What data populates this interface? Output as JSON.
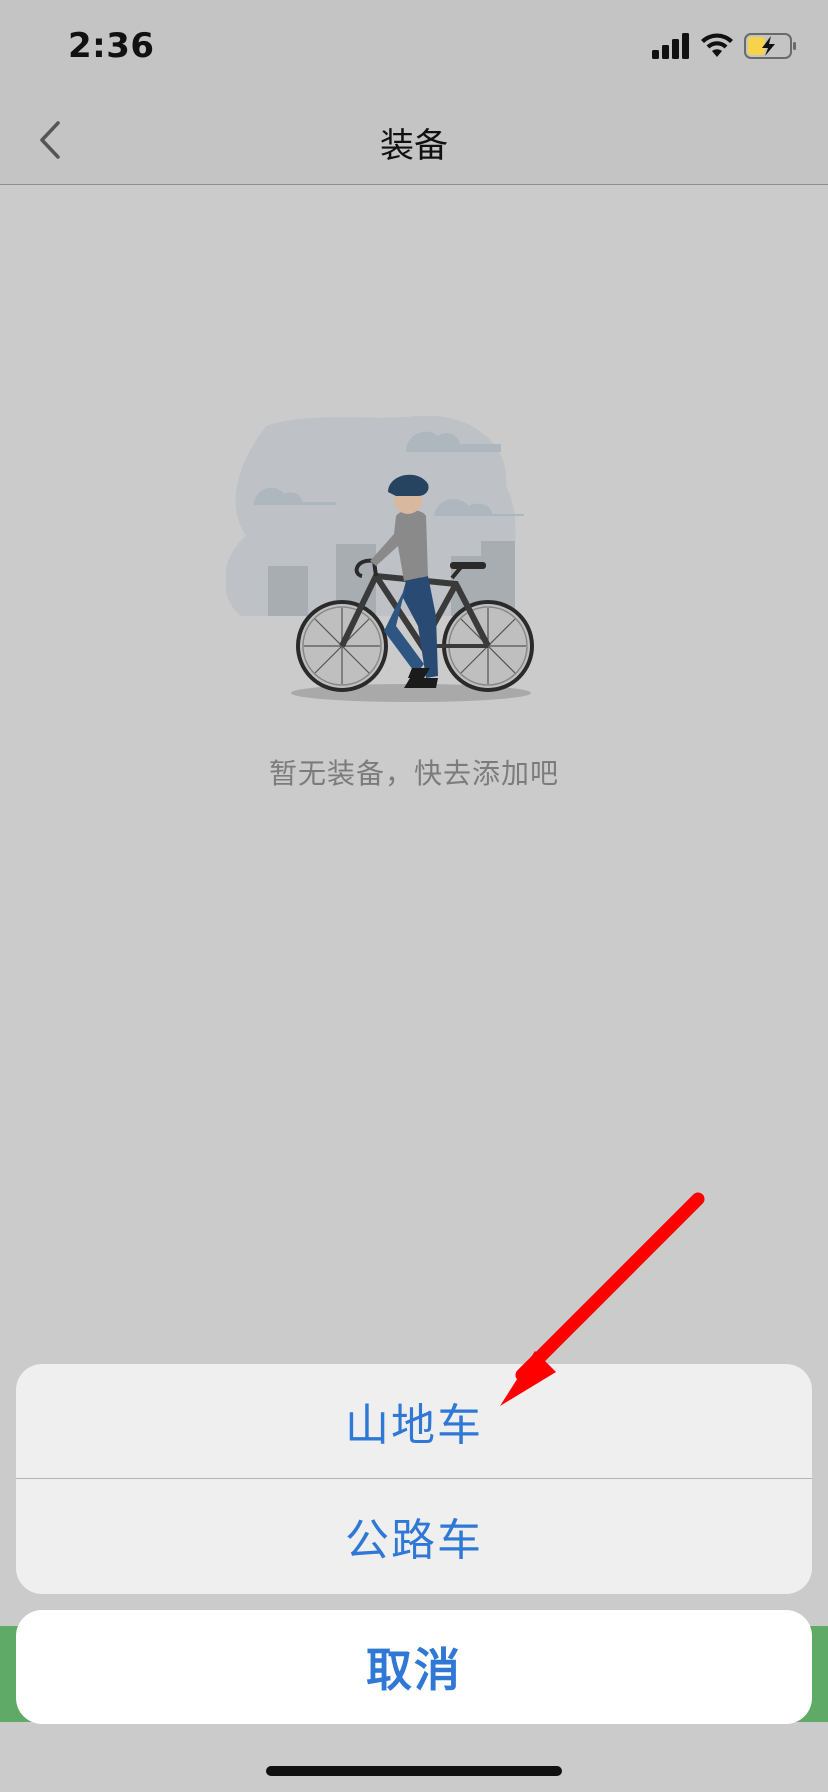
{
  "status_bar": {
    "time": "2:36"
  },
  "nav": {
    "title": "装备"
  },
  "empty_state": {
    "message": "暂无装备，快去添加吧"
  },
  "action_sheet": {
    "options": [
      {
        "label": "山地车"
      },
      {
        "label": "公路车"
      }
    ],
    "cancel_label": "取消"
  },
  "colors": {
    "accent": "#2f78d6",
    "annotation": "#ff0000",
    "battery_fill": "#f5d44b",
    "green_button": "#5eaa66"
  }
}
